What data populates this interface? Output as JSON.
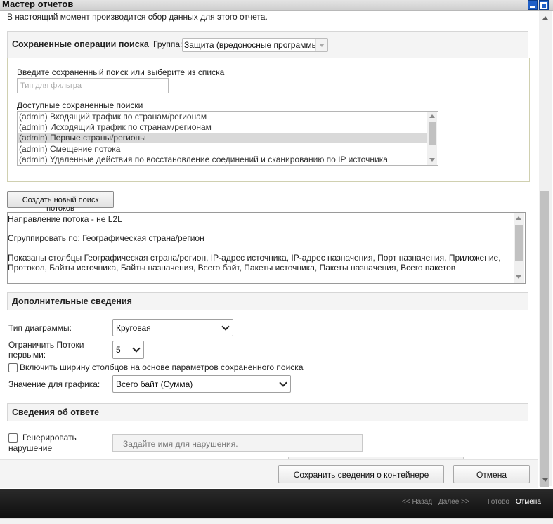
{
  "window": {
    "title": "Мастер отчетов"
  },
  "status_message": "В настоящий момент производится сбор данных для этого отчета.",
  "saved_searches": {
    "header": "Сохраненные операции поиска",
    "group_label": "Группа:",
    "group_value": "Защита (вредоносные программы",
    "filter_prompt": "Введите сохраненный поиск или выберите из списка",
    "filter_placeholder": "Тип для фильтра",
    "available_label": "Доступные сохраненные поиски",
    "items": [
      "(admin) Входящий трафик по странам/регионам",
      "(admin) Исходящий трафик по странам/регионам",
      "(admin) Первые страны/регионы",
      "(admin) Смещение потока",
      "(admin) Удаленные действия по восстановление соединений и сканированию по IP источника"
    ],
    "selected_index": 2
  },
  "create_flow_search_button": "Создать новый поиск потоков",
  "description_lines": [
    "Направление потока - не L2L",
    "Сгруппировать по: Географическая страна/регион",
    "Показаны столбцы Географическая страна/регион, IP-адрес источника, IP-адрес назначения, Порт назначения, Приложение,",
    "Протокол, Байты источника, Байты назначения, Всего байт, Пакеты источника, Пакеты назначения, Всего пакетов"
  ],
  "additional_details": {
    "header": "Дополнительные сведения",
    "chart_type_label": "Тип диаграммы:",
    "chart_type_value": "Круговая",
    "limit_label_line1": "Ограничить Потоки",
    "limit_label_line2": "первыми:",
    "limit_value": "5",
    "column_width_checkbox": "Включить ширину столбцов на основе параметров сохраненного поиска",
    "graph_value_label": "Значение для графика:",
    "graph_value_value": "Всего байт (Сумма)"
  },
  "response_details": {
    "header": "Сведения об ответе",
    "generate_line1": "Генерировать",
    "generate_line2": "нарушение",
    "violation_placeholder": "Задайте имя для нарушения."
  },
  "footer": {
    "save_button": "Сохранить сведения о контейнере",
    "cancel_button": "Отмена"
  },
  "wizard_nav": {
    "back": "<< Назад",
    "next": "Далее >>",
    "finish": "Готово",
    "cancel": "Отмена"
  }
}
